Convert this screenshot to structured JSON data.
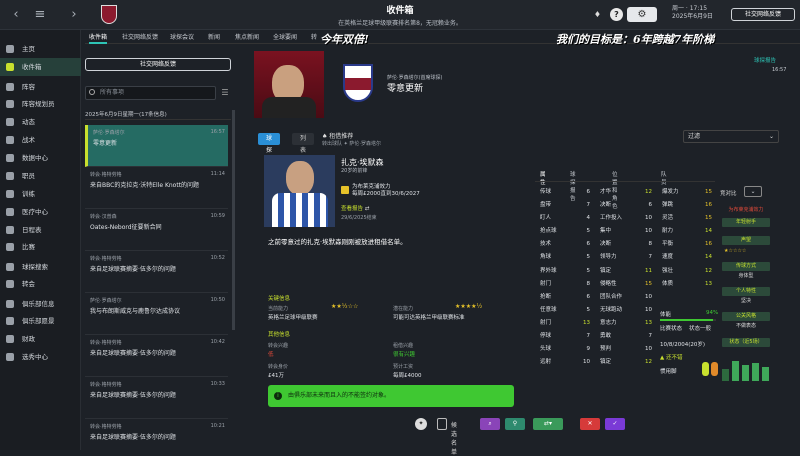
{
  "topbar": {
    "title": "收件箱",
    "subtitle": "在英格兰足球甲级联赛排名第8，无冠赖业务。",
    "date1": "周一 · 17:15",
    "date2": "2025年6月9日",
    "social_btn": "社交网络反馈"
  },
  "sidebar": [
    {
      "label": "主页"
    },
    {
      "label": "收件箱"
    },
    {
      "label": "阵容"
    },
    {
      "label": "阵容规划员"
    },
    {
      "label": "动态"
    },
    {
      "label": "战术"
    },
    {
      "label": "数据中心"
    },
    {
      "label": "职员"
    },
    {
      "label": "训练"
    },
    {
      "label": "医疗中心"
    },
    {
      "label": "日程表"
    },
    {
      "label": "比赛"
    },
    {
      "label": "球探搜索"
    },
    {
      "label": "转会"
    },
    {
      "label": "俱乐部信息"
    },
    {
      "label": "俱乐部愿景"
    },
    {
      "label": "财政"
    },
    {
      "label": "选秀中心"
    }
  ],
  "tabs": [
    "收件箱",
    "社交网络反馈",
    "球探会议",
    "新闻",
    "焦点新闻",
    "全球要闻",
    "转"
  ],
  "overlay_left": "今年双倍!",
  "overlay_right": "我们的目标是：6年跨越7年阶梯",
  "inbox": {
    "social_btn": "社交网络反馈",
    "search_placeholder": "所有事项",
    "date_header": "2025年6月9日星期一(17条信息)",
    "messages": [
      {
        "from": "萨伦·罗森塔尔",
        "subject": "零意更新",
        "time": "16:57"
      },
      {
        "from": "转会·格特劳格",
        "subject": "来自BBC的克拉克·沃特Elle Knott的问题",
        "time": "11:14"
      },
      {
        "from": "转会·汉普森",
        "subject": "Oates-Nebord征要新合同",
        "time": "10:59"
      },
      {
        "from": "转会·格特劳格",
        "subject": "来自足球联赛摘要·伍多尔的问题",
        "time": "10:52"
      },
      {
        "from": "萨伦·罗森塔尔",
        "subject": "我与布朗斯威克与鹿鲁尔达成协议",
        "time": "10:50"
      },
      {
        "from": "转会·格特劳格",
        "subject": "来自足球联赛摘要·伍多尔的问题",
        "time": "10:42"
      },
      {
        "from": "转会·格特劳格",
        "subject": "来自足球联赛摘要·伍多尔的问题",
        "time": "10:33"
      },
      {
        "from": "转会·格特劳格",
        "subject": "来自足球联赛摘要·伍多尔的问题",
        "time": "10:21"
      }
    ]
  },
  "message": {
    "from": "萨伦·罗森塔尔(首席球探)",
    "title": "零意更新",
    "time": "16:57",
    "scout_link": "球探报告",
    "tab_report": "球探卡",
    "tab_list": "列表",
    "loan_label": "租借推荐",
    "loan_sub": "转出球队",
    "loan_who": "萨伦·罗森塔尔",
    "filter": "过滤"
  },
  "player": {
    "name": "扎克·埃默森",
    "info": "20岁的前锋",
    "club_line1": "为布莱克浦效力",
    "club_line2": "每周£2000直到30/6/2027",
    "btn": "查看报告",
    "btn_note": "29/6/2025结束",
    "desc": "之前零意过的扎克·埃默森刚刚被放进租借名单。"
  },
  "details": {
    "section1": "关键信息",
    "curr_ability_lbl": "当前能力",
    "curr_ability_val": "英格兰足球甲级联赛",
    "pot_ability_lbl": "潜在能力",
    "pot_ability_val": "可能可达英格兰甲级联赛标准",
    "section2": "其他信息",
    "l1": "转会兴趣",
    "v1": "低",
    "l2": "租借兴趣",
    "v2": "很有兴趣",
    "l3": "转会身价",
    "v3": "£41万",
    "l4": "预计工资",
    "v4": "每周£4000"
  },
  "notice": "由俱乐部未来而且入的不能签约对象。",
  "attrs": {
    "tabs": [
      "属性",
      "球探报告",
      "位置和角色",
      "队员"
    ],
    "col1": [
      [
        "传球",
        "6"
      ],
      [
        "盘带",
        "7"
      ],
      [
        "盯人",
        "4"
      ],
      [
        "抢点球",
        "5"
      ],
      [
        "技术",
        "6"
      ],
      [
        "角球",
        "5"
      ],
      [
        "界外球",
        "5"
      ],
      [
        "射门",
        "8"
      ],
      [
        "抢断",
        "6"
      ],
      [
        "任意球",
        "5"
      ],
      [
        "射门",
        "13"
      ],
      [
        "停球",
        "7"
      ],
      [
        "头球",
        "9"
      ],
      [
        "远射",
        "10"
      ]
    ],
    "col2": [
      [
        "才华",
        "12"
      ],
      [
        "决断",
        "6"
      ],
      [
        "工作投入",
        "10"
      ],
      [
        "集中",
        "10"
      ],
      [
        "决断",
        "8"
      ],
      [
        "领导力",
        "7"
      ],
      [
        "镇定",
        "11"
      ],
      [
        "侵略性",
        "15"
      ],
      [
        "团队合作",
        "10"
      ],
      [
        "无球跑动",
        "10"
      ],
      [
        "意志力",
        "13"
      ],
      [
        "勇敢",
        "7"
      ],
      [
        "预判",
        "10"
      ],
      [
        "镇定",
        "12"
      ]
    ],
    "col3": [
      [
        "爆发力",
        "15"
      ],
      [
        "弹跳",
        "16"
      ],
      [
        "灵活",
        "15"
      ],
      [
        "耐力",
        "14"
      ],
      [
        "平衡",
        "16"
      ],
      [
        "速度",
        "14"
      ],
      [
        "强壮",
        "12"
      ],
      [
        "体质",
        "13"
      ]
    ],
    "compare": "竞对比",
    "team_tag": "为布莱克浦效力",
    "tag2": "年轻射手",
    "tag3": "声望",
    "tag4": "传球方式",
    "tag5": "身体型",
    "tag6": "个人特性",
    "tag7": "坚决",
    "tag8": "公关风格",
    "tag9": "不做表态",
    "tag10": "状态（近5场）",
    "fitness_lbl": "体能",
    "fitness_val": "94%",
    "form_lbl": "比赛状态",
    "form_val": "状态一般",
    "dob": "10/8/2004(20岁)",
    "foot_lbl": "惯用脚",
    "stat_lbl": "还不错"
  },
  "bottom": {
    "shortlist": "候选名单"
  }
}
